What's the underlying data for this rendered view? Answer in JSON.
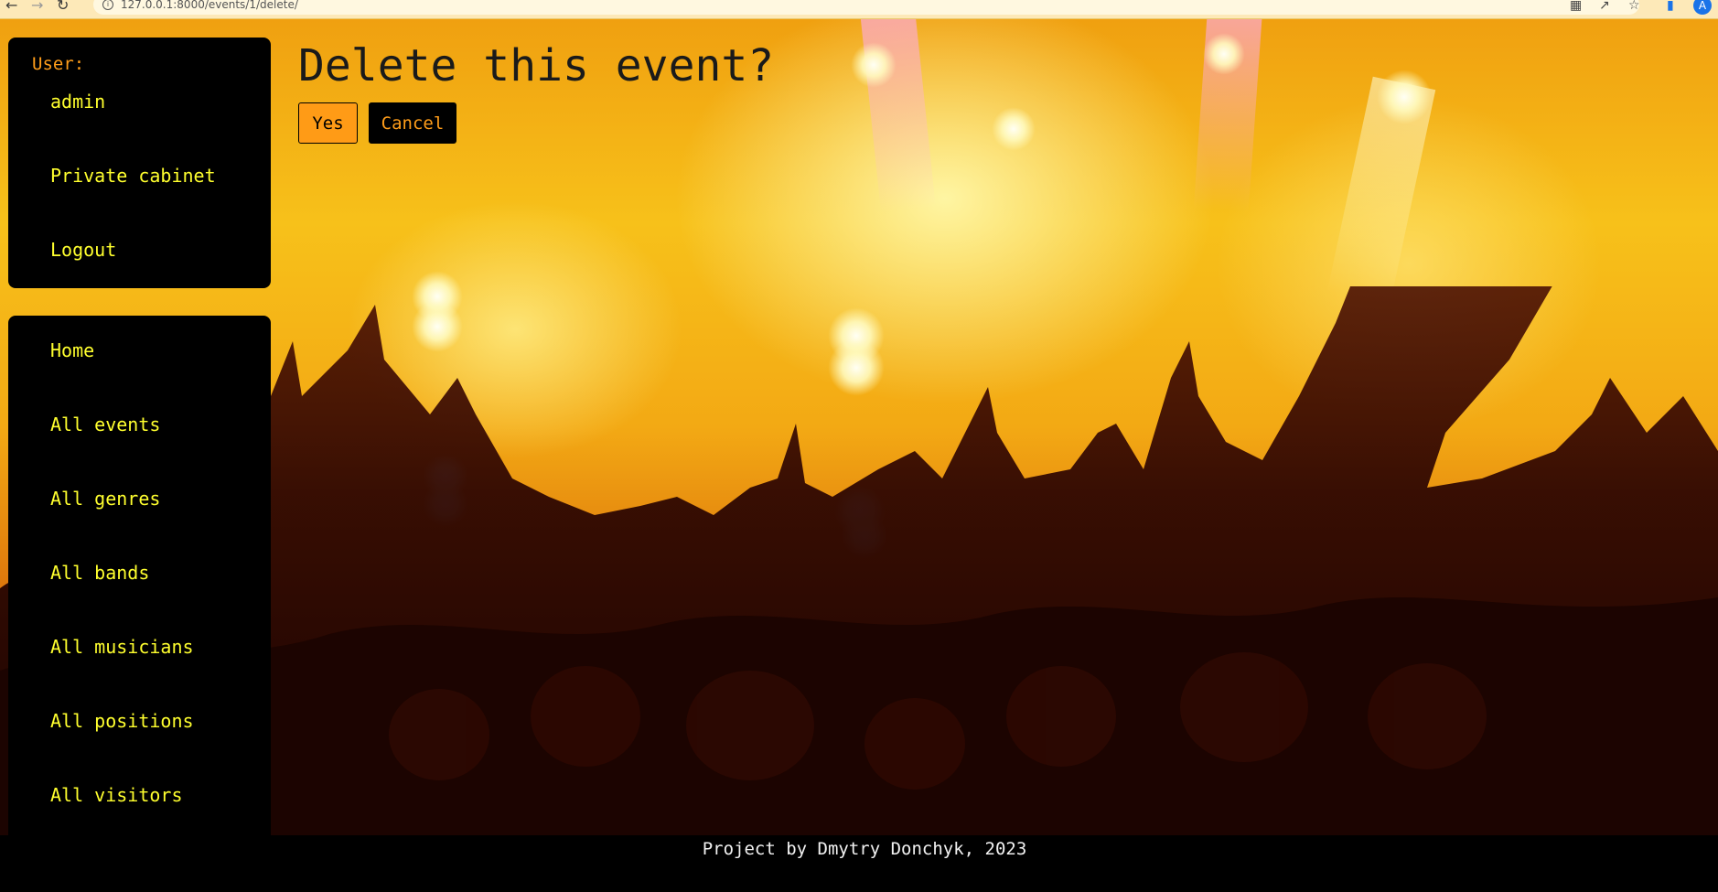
{
  "browser": {
    "url": "127.0.0.1:8000/events/1/delete/",
    "profile_initial": "A"
  },
  "sidebar": {
    "user_label": "User:",
    "username": "admin",
    "account_links": [
      {
        "label": "Private cabinet"
      },
      {
        "label": "Logout"
      }
    ],
    "nav_items": [
      {
        "label": "Home"
      },
      {
        "label": "All events"
      },
      {
        "label": "All genres"
      },
      {
        "label": "All bands"
      },
      {
        "label": "All musicians"
      },
      {
        "label": "All positions"
      },
      {
        "label": "All visitors"
      }
    ]
  },
  "main": {
    "title": "Delete this event?",
    "yes_label": "Yes",
    "cancel_label": "Cancel"
  },
  "footer": {
    "text": "Project by Dmytry Donchyk, 2023"
  },
  "colors": {
    "sidebar_bg": "#000000",
    "link": "#ffff2e",
    "user_label": "#ff9d1a",
    "yes_button": "#ff9b16",
    "cancel_text": "#ff9d1a"
  },
  "icons": [
    "back-arrow-icon",
    "forward-arrow-icon",
    "reload-icon",
    "info-icon",
    "translate-icon",
    "share-icon",
    "star-icon",
    "extension-icon"
  ]
}
